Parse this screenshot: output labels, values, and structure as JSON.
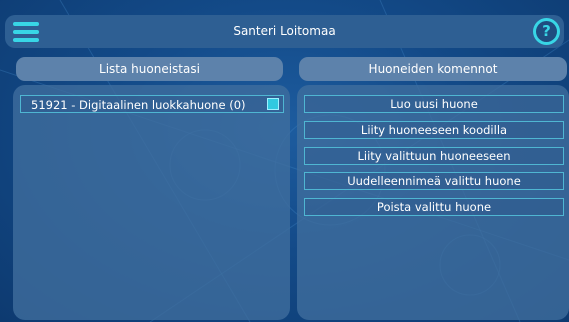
{
  "header": {
    "user_name": "Santeri Loitomaa",
    "menu_icon": "hamburger-menu-icon",
    "help_icon": "question-mark-icon",
    "help_glyph": "?"
  },
  "rooms": {
    "title": "Lista huoneistasi",
    "items": [
      {
        "label": "51921 - Digitaalinen luokkahuone (0)",
        "selected": true
      }
    ]
  },
  "commands": {
    "title": "Huoneiden komennot",
    "buttons": [
      "Luo uusi huone",
      "Liity huoneeseen koodilla",
      "Liity valittuun huoneeseen",
      "Uudelleennimeä valittu huone",
      "Poista valittu huone"
    ]
  },
  "colors": {
    "accent": "#38d6e6",
    "background": "#134a88",
    "panel": "#406e9e"
  }
}
